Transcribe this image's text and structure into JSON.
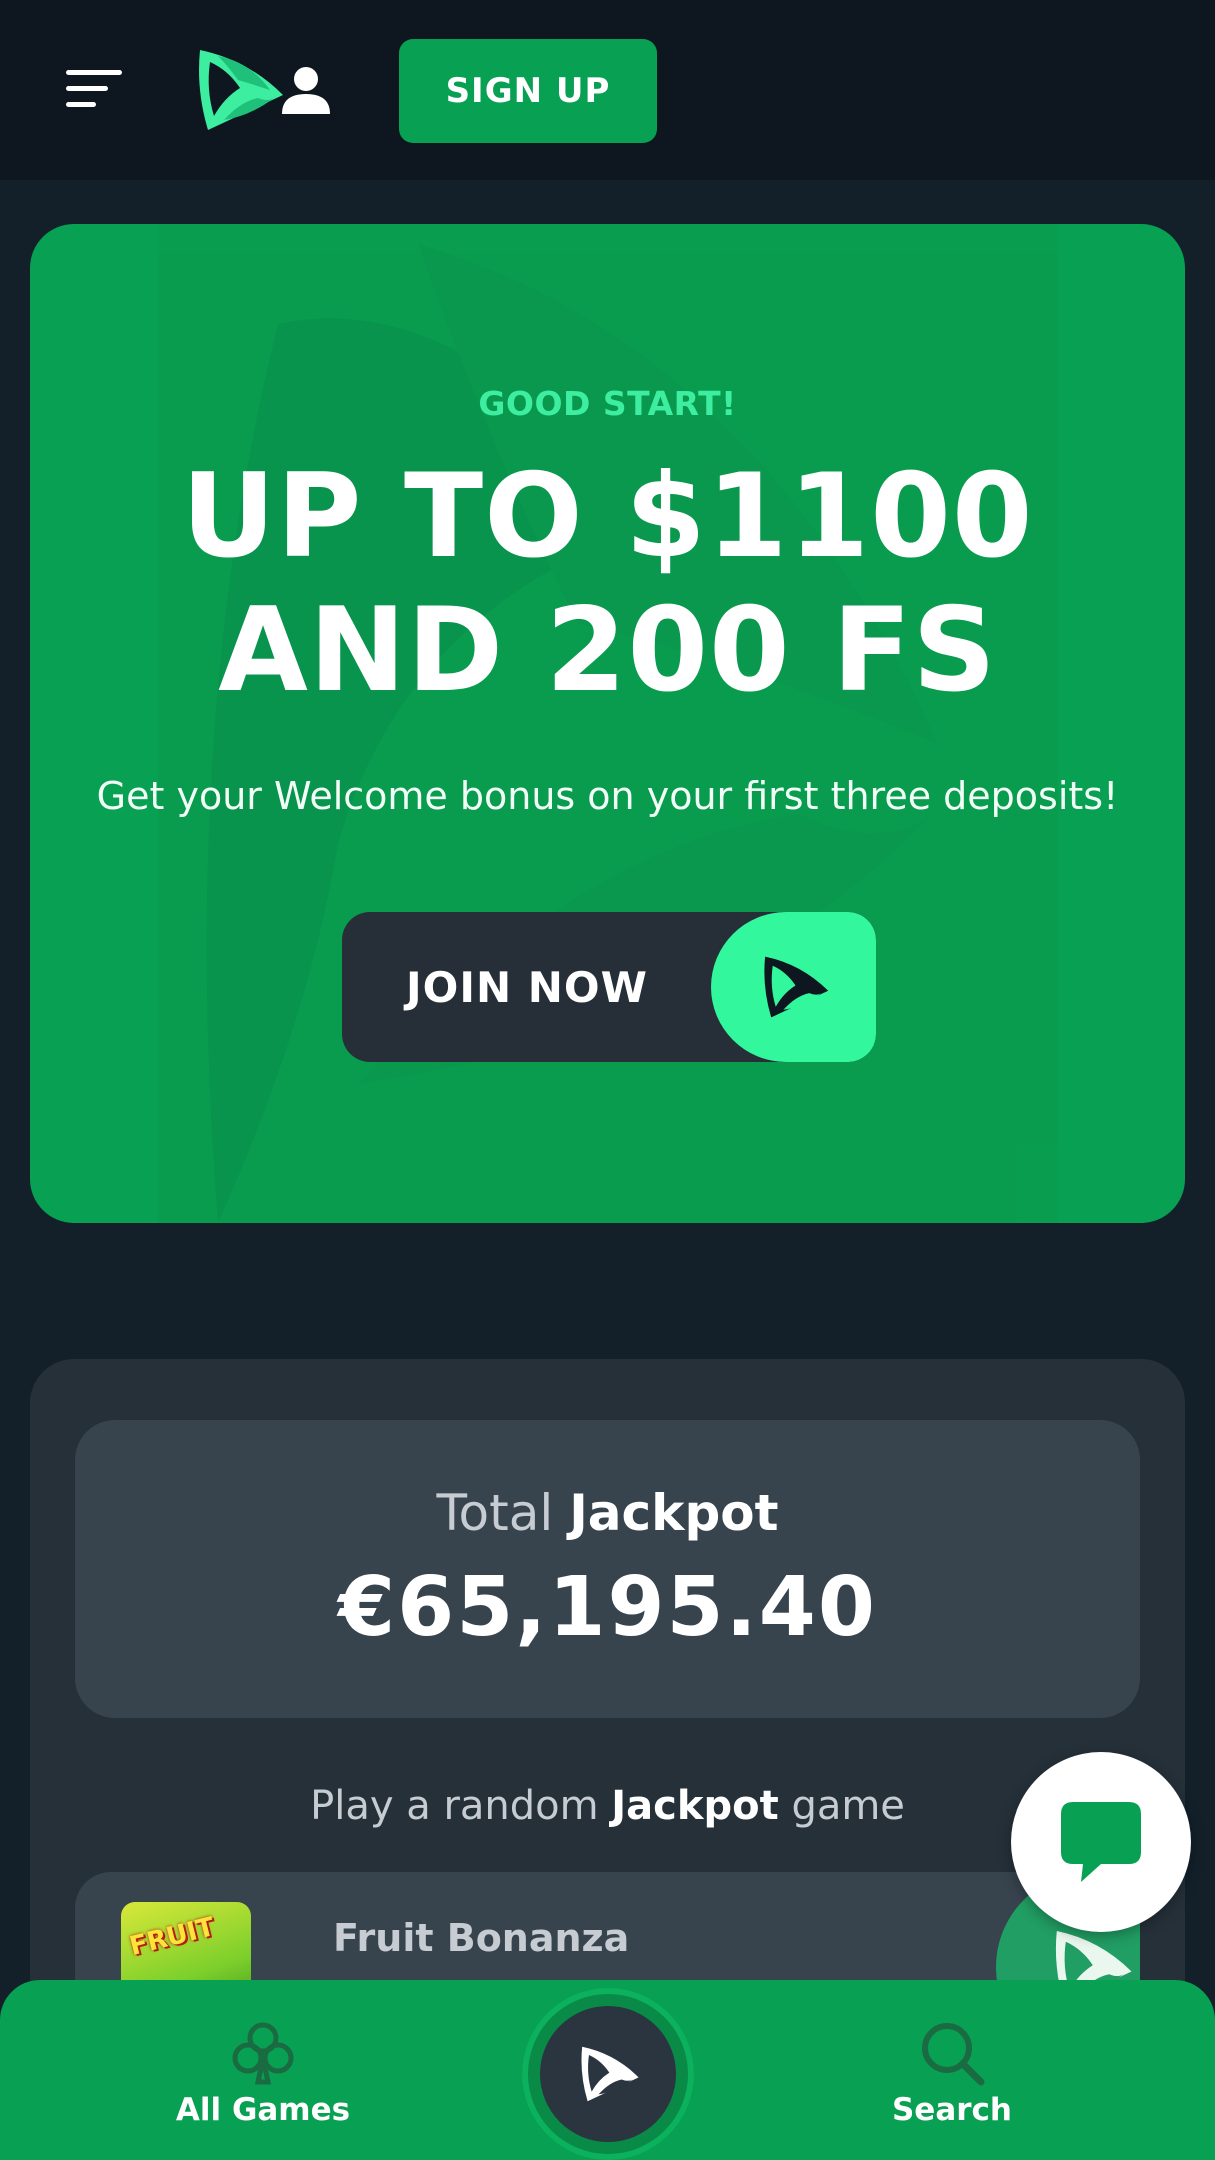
{
  "header": {
    "signup_label": "SIGN UP"
  },
  "promo": {
    "eyebrow": "GOOD START!",
    "headline_line1": "UP TO $1100",
    "headline_line2": "AND 200 FS",
    "subtitle": "Get your Welcome bonus on your first three deposits!",
    "join_label": "JOIN NOW"
  },
  "jackpot": {
    "title_prefix": "Total",
    "title_emphasis": "Jackpot",
    "amount": "€65,195.40",
    "random_prefix": "Play a random",
    "random_emphasis": "Jackpot",
    "random_suffix": "game",
    "game": {
      "name": "Fruit Bonanza",
      "thumb_text": "FRUIT"
    }
  },
  "bottom_nav": {
    "items": [
      {
        "label": "All Games",
        "icon": "club-icon"
      },
      {
        "label": "Search",
        "icon": "search-icon"
      }
    ],
    "center_icon": "logo-icon"
  },
  "colors": {
    "page_bg": "#13202a",
    "header_bg": "#0e171f",
    "brand_green": "#08a052",
    "accent_mint": "#33f79c",
    "dark_card": "#253039",
    "card_inner": "#37444e"
  }
}
